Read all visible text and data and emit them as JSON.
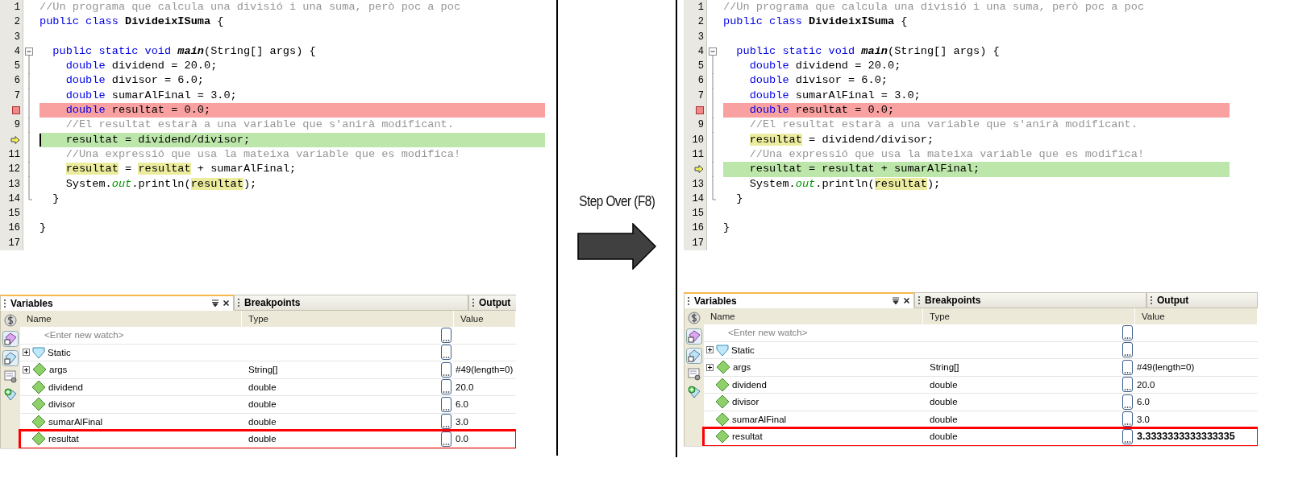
{
  "before": {
    "editor": {
      "lines": [
        {
          "number": "1",
          "kind": "normal",
          "tokens": [
            {
              "text": "//Un programa que calcula una divisió i una suma, però poc a poc",
              "kind": "comment"
            }
          ]
        },
        {
          "number": "2",
          "kind": "normal",
          "tokens": [
            {
              "text": "public class ",
              "kind": "keyword"
            },
            {
              "text": "DivideixISuma",
              "kind": "class"
            },
            {
              "text": " {",
              "kind": "plain"
            }
          ]
        },
        {
          "number": "3",
          "kind": "normal"
        },
        {
          "number": "4",
          "kind": "normal",
          "expanded": true,
          "tokens": [
            {
              "text": "  public static void ",
              "kind": "keyword"
            },
            {
              "text": "main",
              "kind": "method"
            },
            {
              "text": "(String[] args) {",
              "kind": "plain"
            }
          ],
          "children": [
            {
              "number": "5",
              "kind": "normal",
              "tokens": [
                {
                  "text": "    double",
                  "kind": "keyword"
                },
                {
                  "text": " dividend = 20.0;",
                  "kind": "plain"
                }
              ]
            },
            {
              "number": "6",
              "kind": "normal",
              "tokens": [
                {
                  "text": "    double",
                  "kind": "keyword"
                },
                {
                  "text": " divisor = 6.0;",
                  "kind": "plain"
                }
              ]
            },
            {
              "number": "7",
              "kind": "normal",
              "tokens": [
                {
                  "text": "    double",
                  "kind": "keyword"
                },
                {
                  "text": " sumarAlFinal = 3.0;",
                  "kind": "plain"
                }
              ]
            },
            {
              "kind": "breakpoint",
              "tokens": [
                {
                  "text": "    double",
                  "kind": "keyword"
                },
                {
                  "text": " resultat = 0.0;",
                  "kind": "plain"
                }
              ]
            },
            {
              "number": "9",
              "kind": "normal",
              "tokens": [
                {
                  "text": "    //El resultat estarà a una variable que s'anirà modificant.",
                  "kind": "comment"
                }
              ]
            },
            {
              "kind": "current",
              "cursor": true,
              "tokens": [
                {
                  "text": "    resultat = dividend/divisor;",
                  "kind": "plain"
                }
              ]
            },
            {
              "number": "11",
              "kind": "normal",
              "tokens": [
                {
                  "text": "    //Una expressió que usa la mateixa variable que es modifica!",
                  "kind": "comment"
                }
              ]
            },
            {
              "number": "12",
              "kind": "normal",
              "tokens": [
                {
                  "text": "    resultat",
                  "kind": "usage"
                },
                {
                  "text": " = ",
                  "kind": "plain"
                },
                {
                  "text": "resultat",
                  "kind": "usage"
                },
                {
                  "text": " + sumarAlFinal;",
                  "kind": "plain"
                }
              ]
            },
            {
              "number": "13",
              "kind": "normal",
              "tokens": [
                {
                  "text": "    System.",
                  "kind": "plain"
                },
                {
                  "text": "out",
                  "kind": "field"
                },
                {
                  "text": ".println(",
                  "kind": "plain"
                },
                {
                  "text": "resultat",
                  "kind": "usage"
                },
                {
                  "text": ");",
                  "kind": "plain"
                }
              ]
            },
            {
              "number": "14",
              "kind": "normal",
              "tokens": [
                {
                  "text": "  }",
                  "kind": "plain"
                }
              ]
            }
          ]
        },
        {
          "number": "15",
          "kind": "normal"
        },
        {
          "number": "16",
          "kind": "normal",
          "tokens": [
            {
              "text": "}",
              "kind": "plain"
            }
          ]
        },
        {
          "number": "17",
          "kind": "normal"
        }
      ]
    },
    "debugger": {
      "tabs": [
        {
          "label": "Variables",
          "selected": true
        },
        {
          "label": "Breakpoints",
          "selected": false
        },
        {
          "label": "Output",
          "selected": false
        }
      ],
      "columns": [
        "Name",
        "Type",
        "Value"
      ],
      "rows": [
        {
          "kind": "watch",
          "name": "<Enter new watch>",
          "expandable": false,
          "highlighted": false
        },
        {
          "kind": "static",
          "name": "Static",
          "expandable": true,
          "highlighted": false
        },
        {
          "kind": "variable",
          "name": "args",
          "type": "String[]",
          "value": "#49(length=0)",
          "expandable": true,
          "changed": false,
          "highlighted": false
        },
        {
          "kind": "variable",
          "name": "dividend",
          "type": "double",
          "value": "20.0",
          "expandable": false,
          "changed": false,
          "highlighted": false
        },
        {
          "kind": "variable",
          "name": "divisor",
          "type": "double",
          "value": "6.0",
          "expandable": false,
          "changed": false,
          "highlighted": false
        },
        {
          "kind": "variable",
          "name": "sumarAlFinal",
          "type": "double",
          "value": "3.0",
          "expandable": false,
          "changed": false,
          "highlighted": false
        },
        {
          "kind": "variable",
          "name": "resultat",
          "type": "double",
          "value": "0.0",
          "expandable": false,
          "changed": false,
          "highlighted": true
        }
      ]
    }
  },
  "step": {
    "caption": "Step Over (F8)"
  },
  "after": {
    "editor": {
      "lines": [
        {
          "number": "1",
          "kind": "normal",
          "tokens": [
            {
              "text": "//Un programa que calcula una divisió i una suma, però poc a poc",
              "kind": "comment"
            }
          ]
        },
        {
          "number": "2",
          "kind": "normal",
          "tokens": [
            {
              "text": "public class ",
              "kind": "keyword"
            },
            {
              "text": "DivideixISuma",
              "kind": "class"
            },
            {
              "text": " {",
              "kind": "plain"
            }
          ]
        },
        {
          "number": "3",
          "kind": "normal"
        },
        {
          "number": "4",
          "kind": "normal",
          "expanded": true,
          "tokens": [
            {
              "text": "  public static void ",
              "kind": "keyword"
            },
            {
              "text": "main",
              "kind": "method"
            },
            {
              "text": "(String[] args) {",
              "kind": "plain"
            }
          ],
          "children": [
            {
              "number": "5",
              "kind": "normal",
              "tokens": [
                {
                  "text": "    double",
                  "kind": "keyword"
                },
                {
                  "text": " dividend = 20.0;",
                  "kind": "plain"
                }
              ]
            },
            {
              "number": "6",
              "kind": "normal",
              "tokens": [
                {
                  "text": "    double",
                  "kind": "keyword"
                },
                {
                  "text": " divisor = 6.0;",
                  "kind": "plain"
                }
              ]
            },
            {
              "number": "7",
              "kind": "normal",
              "tokens": [
                {
                  "text": "    double",
                  "kind": "keyword"
                },
                {
                  "text": " sumarAlFinal = 3.0;",
                  "kind": "plain"
                }
              ]
            },
            {
              "kind": "breakpoint",
              "tokens": [
                {
                  "text": "    double",
                  "kind": "keyword"
                },
                {
                  "text": " resultat = 0.0;",
                  "kind": "plain"
                }
              ]
            },
            {
              "number": "9",
              "kind": "normal",
              "tokens": [
                {
                  "text": "    //El resultat estarà a una variable que s'anirà modificant.",
                  "kind": "comment"
                }
              ]
            },
            {
              "number": "10",
              "kind": "normal",
              "tokens": [
                {
                  "text": "    resultat",
                  "kind": "usage"
                },
                {
                  "text": " = dividend/divisor;",
                  "kind": "plain"
                }
              ]
            },
            {
              "number": "11",
              "kind": "normal",
              "tokens": [
                {
                  "text": "    //Una expressió que usa la mateixa variable que es modifica!",
                  "kind": "comment"
                }
              ]
            },
            {
              "kind": "current",
              "cursor": false,
              "tokens": [
                {
                  "text": "    resultat = resultat + sumarAlFinal;",
                  "kind": "plain"
                }
              ]
            },
            {
              "number": "13",
              "kind": "normal",
              "tokens": [
                {
                  "text": "    System.",
                  "kind": "plain"
                },
                {
                  "text": "out",
                  "kind": "field"
                },
                {
                  "text": ".println(",
                  "kind": "plain"
                },
                {
                  "text": "resultat",
                  "kind": "usage"
                },
                {
                  "text": ");",
                  "kind": "plain"
                }
              ]
            },
            {
              "number": "14",
              "kind": "normal",
              "tokens": [
                {
                  "text": "  }",
                  "kind": "plain"
                }
              ]
            }
          ]
        },
        {
          "number": "15",
          "kind": "normal"
        },
        {
          "number": "16",
          "kind": "normal",
          "tokens": [
            {
              "text": "}",
              "kind": "plain"
            }
          ]
        },
        {
          "number": "17",
          "kind": "normal"
        }
      ]
    },
    "debugger": {
      "tabs": [
        {
          "label": "Variables",
          "selected": true
        },
        {
          "label": "Breakpoints",
          "selected": false
        },
        {
          "label": "Output",
          "selected": false
        }
      ],
      "columns": [
        "Name",
        "Type",
        "Value"
      ],
      "rows": [
        {
          "kind": "watch",
          "name": "<Enter new watch>",
          "expandable": false,
          "highlighted": false
        },
        {
          "kind": "static",
          "name": "Static",
          "expandable": true,
          "highlighted": false
        },
        {
          "kind": "variable",
          "name": "args",
          "type": "String[]",
          "value": "#49(length=0)",
          "expandable": true,
          "changed": false,
          "highlighted": false
        },
        {
          "kind": "variable",
          "name": "dividend",
          "type": "double",
          "value": "20.0",
          "expandable": false,
          "changed": false,
          "highlighted": false
        },
        {
          "kind": "variable",
          "name": "divisor",
          "type": "double",
          "value": "6.0",
          "expandable": false,
          "changed": false,
          "highlighted": false
        },
        {
          "kind": "variable",
          "name": "sumarAlFinal",
          "type": "double",
          "value": "3.0",
          "expandable": false,
          "changed": false,
          "highlighted": false
        },
        {
          "kind": "variable",
          "name": "resultat",
          "type": "double",
          "value": "3.3333333333333335",
          "expandable": false,
          "changed": true,
          "highlighted": true
        }
      ]
    }
  }
}
